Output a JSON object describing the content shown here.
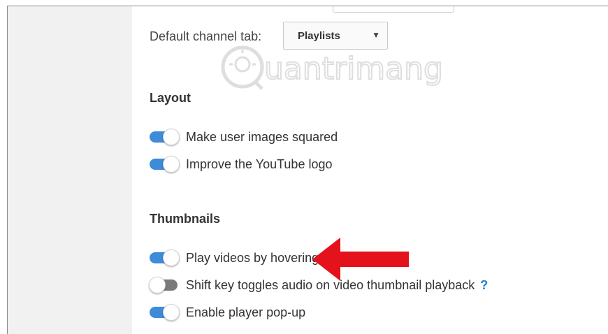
{
  "channel": {
    "label": "Default channel tab:",
    "select_value": "Playlists",
    "select_arrow": "▼"
  },
  "layout": {
    "heading": "Layout",
    "items": [
      {
        "label": "Make user images squared",
        "enabled": true
      },
      {
        "label": "Improve the YouTube logo",
        "enabled": true
      }
    ]
  },
  "thumbnails": {
    "heading": "Thumbnails",
    "items": [
      {
        "label": "Play videos by hovering the thumbnails",
        "enabled": true
      },
      {
        "label": "Shift key toggles audio on video thumbnail playback",
        "enabled": false,
        "help": "?"
      },
      {
        "label": "Enable player pop-up",
        "enabled": true
      }
    ]
  },
  "watermark": {
    "text": "uantrimang"
  },
  "colors": {
    "toggle_on": "#3e8bd8",
    "toggle_off": "#7a7a7a",
    "help": "#1e7fd0",
    "arrow": "#e3121b"
  }
}
